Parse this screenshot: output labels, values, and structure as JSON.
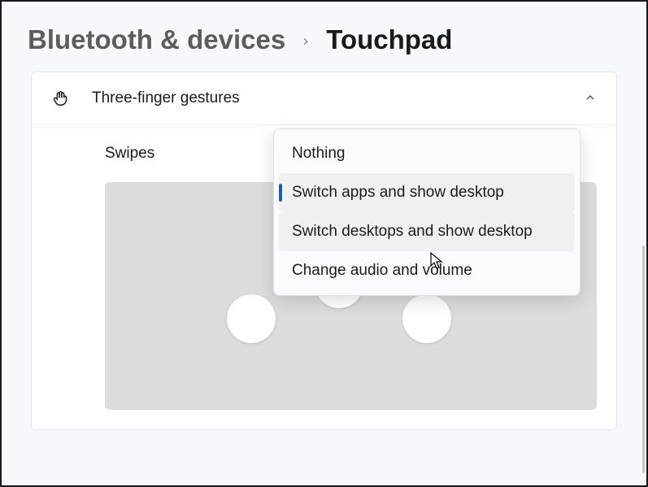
{
  "breadcrumb": {
    "parent": "Bluetooth & devices",
    "current": "Touchpad"
  },
  "section": {
    "title": "Three-finger gestures",
    "swipes_label": "Swipes"
  },
  "dropdown": {
    "options": [
      {
        "label": "Nothing"
      },
      {
        "label": "Switch apps and show desktop"
      },
      {
        "label": "Switch desktops and show desktop"
      },
      {
        "label": "Change audio and volume"
      }
    ],
    "selected_index": 1,
    "hovered_index": 2
  }
}
